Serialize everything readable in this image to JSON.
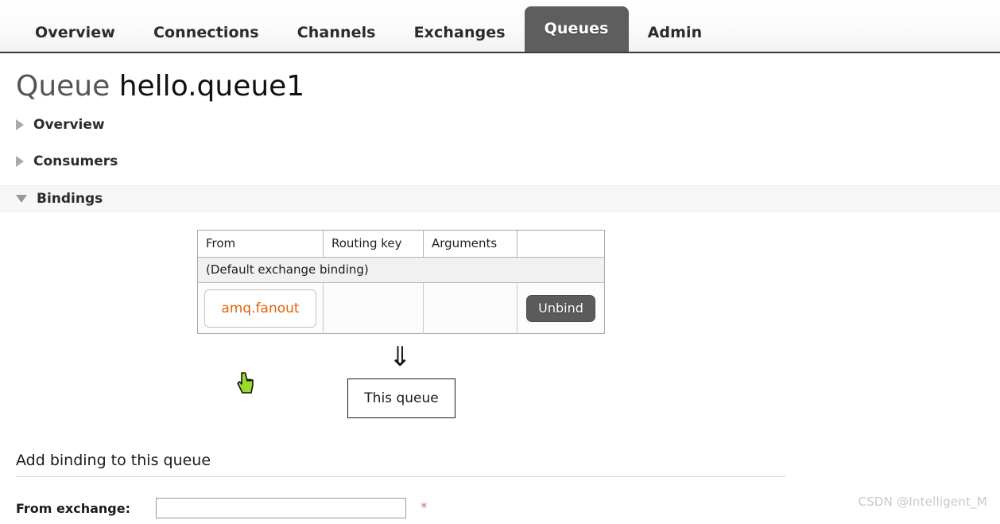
{
  "nav": {
    "tabs": [
      {
        "label": "Overview",
        "active": false
      },
      {
        "label": "Connections",
        "active": false
      },
      {
        "label": "Channels",
        "active": false
      },
      {
        "label": "Exchanges",
        "active": false
      },
      {
        "label": "Queues",
        "active": true
      },
      {
        "label": "Admin",
        "active": false
      }
    ],
    "active_tab": "Queues"
  },
  "page": {
    "object_type": "Queue",
    "object_name": "hello.queue1"
  },
  "sections": [
    {
      "label": "Overview",
      "expanded": false,
      "icon": "triangle-right-icon"
    },
    {
      "label": "Consumers",
      "expanded": false,
      "icon": "triangle-right-icon"
    },
    {
      "label": "Bindings",
      "expanded": true,
      "icon": "triangle-down-icon"
    }
  ],
  "bindings_table": {
    "columns": [
      "From",
      "Routing key",
      "Arguments",
      ""
    ],
    "default_binding_row": "(Default exchange binding)",
    "rows": [
      {
        "from": "amq.fanout",
        "routing_key": "",
        "arguments": "",
        "action_label": "Unbind"
      }
    ]
  },
  "flow": {
    "arrow_glyph": "⇓",
    "target_box_label": "This queue"
  },
  "add_binding": {
    "heading": "Add binding to this queue",
    "from_exchange_label": "From exchange:",
    "from_exchange_value": "",
    "from_exchange_placeholder": "",
    "required_marker": "*"
  },
  "watermark": {
    "text": "CSDN @Intelligent_M"
  },
  "colors": {
    "active_tab_bg": "#5e5e5e",
    "link_orange": "#e2620d",
    "button_gray": "#5b5b5b",
    "section_band": "#f7f7f7",
    "required_star": "#cc7a7a",
    "cursor_green": "#9ada2a"
  }
}
